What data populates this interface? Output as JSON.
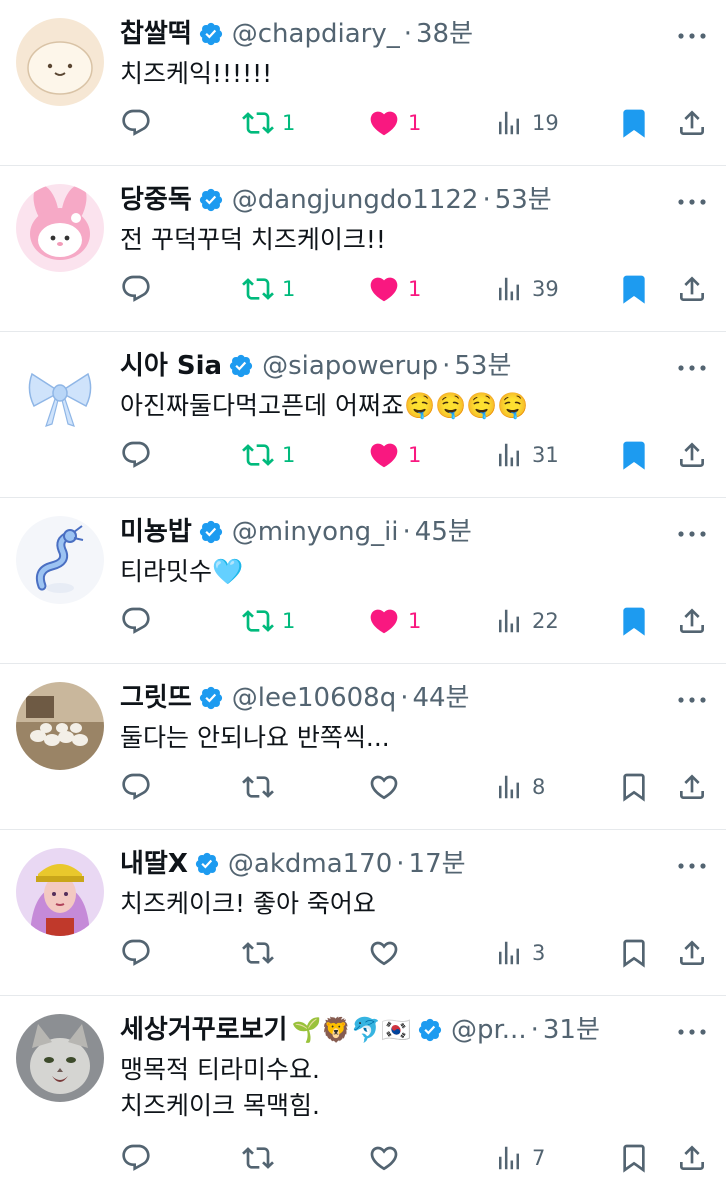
{
  "colors": {
    "accent": "#1d9bf0",
    "retweet_active": "#00ba7c",
    "like_active": "#f91880",
    "muted": "#536471",
    "text": "#0f1419"
  },
  "icons": {
    "reply": "reply-icon",
    "retweet": "retweet-icon",
    "like": "heart-icon",
    "views": "views-icon",
    "bookmark": "bookmark-icon",
    "share": "share-icon",
    "more": "more-icon",
    "verified": "verified-badge-icon"
  },
  "tweets": [
    {
      "name": "찹쌀떡",
      "name_emoji": "",
      "handle": "@chapdiary_",
      "separator": "·",
      "time": "38분",
      "text": "치즈케익!!!!!!",
      "retweets": "1",
      "likes": "1",
      "views": "19",
      "retweeted": true,
      "liked": true,
      "bookmarked": true,
      "avatar": "mochi-avatar"
    },
    {
      "name": "당중독",
      "name_emoji": "",
      "handle": "@dangjungdo1122",
      "separator": "·",
      "time": "53분",
      "text": "전 꾸덕꾸덕 치즈케이크!!",
      "retweets": "1",
      "likes": "1",
      "views": "39",
      "retweeted": true,
      "liked": true,
      "bookmarked": true,
      "avatar": "my-melody-avatar"
    },
    {
      "name": "시아 Sia",
      "name_emoji": "",
      "handle": "@siapowerup",
      "separator": "·",
      "time": "53분",
      "text": "아진짜둘다먹고픈데 어쩌죠🤤🤤🤤🤤",
      "retweets": "1",
      "likes": "1",
      "views": "31",
      "retweeted": true,
      "liked": true,
      "bookmarked": true,
      "avatar": "ribbon-avatar"
    },
    {
      "name": "미뇽밥",
      "name_emoji": "",
      "handle": "@minyong_ii",
      "separator": "·",
      "time": "45분",
      "text": "티라밋수🩵",
      "retweets": "1",
      "likes": "1",
      "views": "22",
      "retweeted": true,
      "liked": true,
      "bookmarked": true,
      "avatar": "dragonair-avatar"
    },
    {
      "name": "그릿뜨",
      "name_emoji": "",
      "handle": "@lee10608q",
      "separator": "·",
      "time": "44분",
      "text": "둘다는 안되나요 반쪽씩...",
      "retweets": "",
      "likes": "",
      "views": "8",
      "retweeted": false,
      "liked": false,
      "bookmarked": false,
      "avatar": "goats-photo-avatar"
    },
    {
      "name": "내딸X",
      "name_emoji": "",
      "handle": "@akdma170",
      "separator": "·",
      "time": "17분",
      "text": "치즈케이크! 좋아 죽어요",
      "retweets": "",
      "likes": "",
      "views": "3",
      "retweeted": false,
      "liked": false,
      "bookmarked": false,
      "avatar": "cartoon-girl-avatar"
    },
    {
      "name": "세상거꾸로보기",
      "name_emoji": "🌱🦁🐬🇰🇷",
      "handle": "@pr...",
      "separator": "·",
      "time": "31분",
      "text": "맹목적 티라미수요.\n치즈케이크 목맥힘.",
      "retweets": "",
      "likes": "",
      "views": "7",
      "retweeted": false,
      "liked": false,
      "bookmarked": false,
      "avatar": "cat-photo-avatar"
    }
  ]
}
